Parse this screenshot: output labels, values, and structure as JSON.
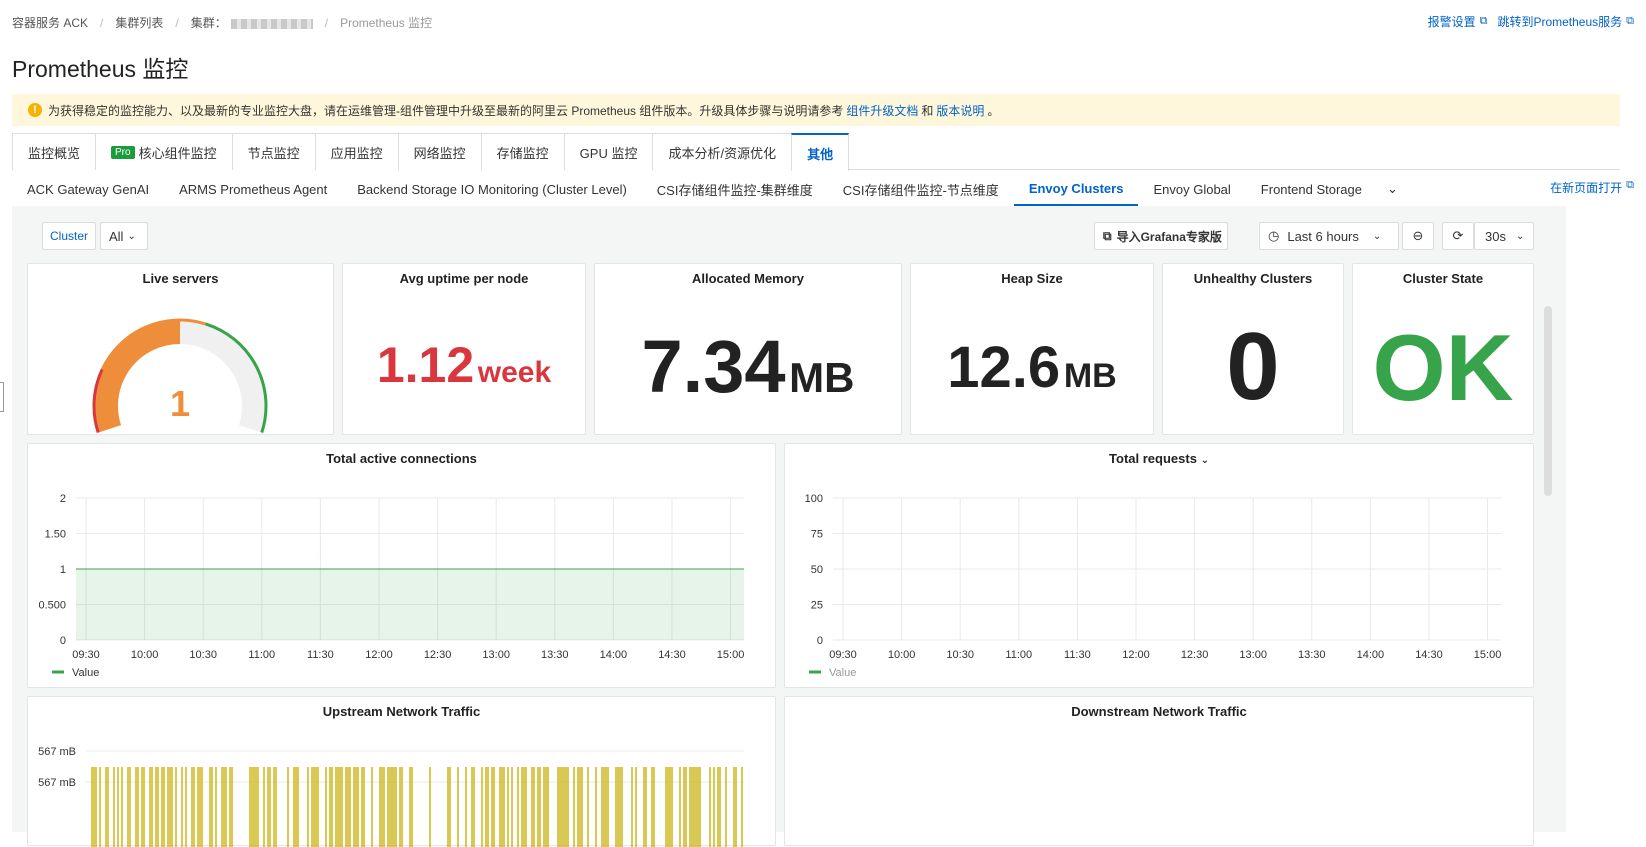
{
  "breadcrumb": {
    "items": [
      "容器服务 ACK",
      "集群列表",
      "集群：",
      "Prometheus 监控"
    ]
  },
  "top_links": {
    "alarm": "报警设置",
    "jump": "跳转到Prometheus服务"
  },
  "page_title": "Prometheus 监控",
  "notice": {
    "text": "为获得稳定的监控能力、以及最新的专业监控大盘，请在运维管理-组件管理中升级至最新的阿里云 Prometheus 组件版本。升级具体步骤与说明请参考",
    "link1": "组件升级文档",
    "and": "和",
    "link2": "版本说明",
    "end": "。"
  },
  "main_tabs": [
    {
      "label": "监控概览"
    },
    {
      "label": "核心组件监控",
      "badge": "Pro"
    },
    {
      "label": "节点监控"
    },
    {
      "label": "应用监控"
    },
    {
      "label": "网络监控"
    },
    {
      "label": "存储监控"
    },
    {
      "label": "GPU 监控"
    },
    {
      "label": "成本分析/资源优化"
    },
    {
      "label": "其他",
      "active": true
    }
  ],
  "sub_tabs": [
    {
      "label": "ACK Gateway GenAI"
    },
    {
      "label": "ARMS Prometheus Agent"
    },
    {
      "label": "Backend Storage IO Monitoring (Cluster Level)"
    },
    {
      "label": "CSI存储组件监控-集群维度"
    },
    {
      "label": "CSI存储组件监控-节点维度"
    },
    {
      "label": "Envoy Clusters",
      "active": true
    },
    {
      "label": "Envoy Global"
    },
    {
      "label": "Frontend Storage"
    }
  ],
  "open_new_page": "在新页面打开",
  "controls": {
    "cluster_label": "Cluster",
    "cluster_value": "All",
    "grafana": "导入Grafana专家版",
    "time_range": "Last 6 hours",
    "refresh": "30s"
  },
  "stats": {
    "live_servers": {
      "title": "Live servers",
      "value": "1",
      "gauge_fraction": 0.5
    },
    "avg_uptime": {
      "title": "Avg uptime per node",
      "value": "1.12",
      "unit": "week"
    },
    "allocated_memory": {
      "title": "Allocated Memory",
      "value": "7.34",
      "unit": "MB"
    },
    "heap_size": {
      "title": "Heap Size",
      "value": "12.6",
      "unit": "MB"
    },
    "unhealthy": {
      "title": "Unhealthy Clusters",
      "value": "0"
    },
    "cluster_state": {
      "title": "Cluster State",
      "value": "OK"
    }
  },
  "colors": {
    "accent": "#0064c8",
    "green": "#37a34a",
    "red": "#d9363e",
    "orange": "#ef8e3a",
    "yellow": "#c9b20c"
  },
  "chart_data": [
    {
      "type": "area",
      "title": "Total active connections",
      "x": [
        "09:30",
        "10:00",
        "10:30",
        "11:00",
        "11:30",
        "12:00",
        "12:30",
        "13:00",
        "13:30",
        "14:00",
        "14:30",
        "15:00"
      ],
      "y_ticks": [
        "0",
        "0.500",
        "1",
        "1.50",
        "2"
      ],
      "ylim": [
        0,
        2
      ],
      "series": [
        {
          "name": "Value",
          "values": [
            1,
            1,
            1,
            1,
            1,
            1,
            1,
            1,
            1,
            1,
            1,
            1
          ]
        }
      ],
      "legend": "bottom-left"
    },
    {
      "type": "line",
      "title": "Total requests",
      "x": [
        "09:30",
        "10:00",
        "10:30",
        "11:00",
        "11:30",
        "12:00",
        "12:30",
        "13:00",
        "13:30",
        "14:00",
        "14:30",
        "15:00"
      ],
      "y_ticks": [
        "0",
        "25",
        "50",
        "75",
        "100"
      ],
      "ylim": [
        0,
        100
      ],
      "series": [
        {
          "name": "Value",
          "values": []
        }
      ],
      "legend": "bottom-left"
    },
    {
      "type": "bar",
      "title": "Upstream Network Traffic",
      "y_ticks": [
        "567 mB",
        "567 mB"
      ]
    },
    {
      "type": "line",
      "title": "Downstream Network Traffic"
    }
  ]
}
